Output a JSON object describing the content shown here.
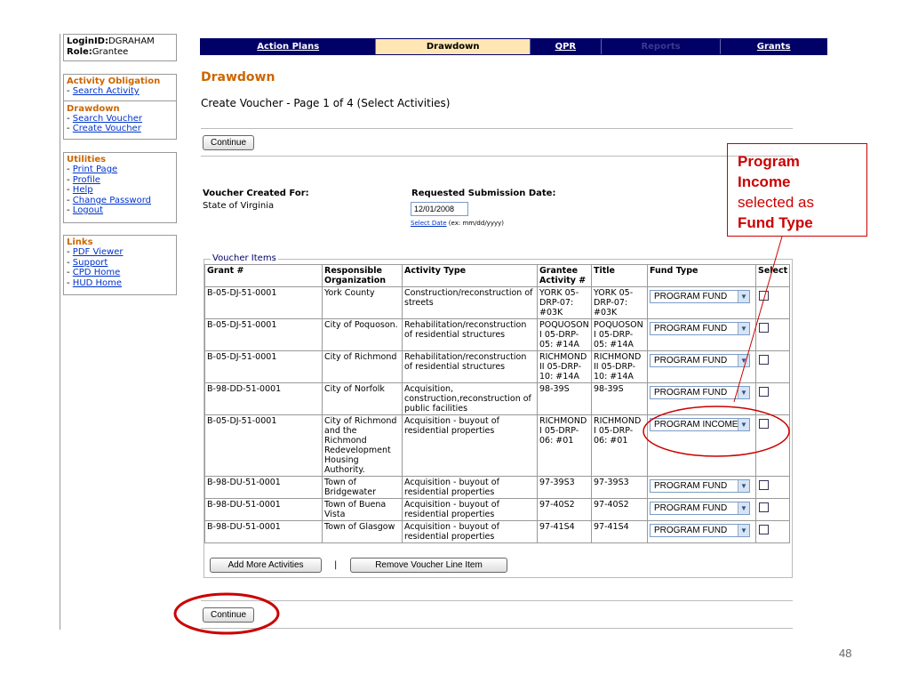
{
  "login": {
    "id_label": "LoginID:",
    "id_value": "DGRAHAM",
    "role_label": "Role:",
    "role_value": "Grantee"
  },
  "sidebar": {
    "activity_title": "Activity Obligation",
    "activity_items": [
      "Search Activity"
    ],
    "drawdown_title": "Drawdown",
    "drawdown_items": [
      "Search Voucher",
      "Create Voucher"
    ],
    "utilities_title": "Utilities",
    "utilities_items": [
      "Print Page",
      "Profile",
      "Help",
      "Change Password",
      "Logout"
    ],
    "links_title": "Links",
    "links_items": [
      "PDF Viewer",
      "Support",
      "CPD Home",
      "HUD Home"
    ]
  },
  "nav": {
    "tabs": [
      "Action Plans",
      "Drawdown",
      "QPR",
      "Reports",
      "Grants"
    ]
  },
  "page": {
    "title": "Drawdown",
    "subtitle": "Create Voucher - Page 1 of 4 (Select Activities)",
    "continue_label": "Continue",
    "voucher_for_label": "Voucher Created For:",
    "voucher_for_value": "State of Virginia",
    "submission_label": "Requested Submission Date:",
    "submission_value": "12/01/2008",
    "select_date": "Select Date",
    "date_hint": "(ex: mm/dd/yyyy)",
    "legend": "Voucher Items",
    "add_more": "Add More Activities",
    "pipe": "|",
    "remove": "Remove Voucher Line Item"
  },
  "table": {
    "headers": [
      "Grant #",
      "Responsible Organization",
      "Activity Type",
      "Grantee Activity #",
      "Title",
      "Fund Type",
      "Select"
    ],
    "rows": [
      {
        "grant": "B-05-DJ-51-0001",
        "org": "York County",
        "activity": "Construction/reconstruction of streets",
        "gid": "YORK 05-DRP-07: #03K",
        "title": "YORK 05-DRP-07: #03K",
        "fund": "PROGRAM FUND"
      },
      {
        "grant": "B-05-DJ-51-0001",
        "org": "City of Poquoson.",
        "activity": "Rehabilitation/reconstruction of residential structures",
        "gid": "POQUOSON I 05-DRP-05: #14A",
        "title": "POQUOSON I 05-DRP-05: #14A",
        "fund": "PROGRAM FUND"
      },
      {
        "grant": "B-05-DJ-51-0001",
        "org": "City of Richmond",
        "activity": "Rehabilitation/reconstruction of residential structures",
        "gid": "RICHMOND II 05-DRP-10: #14A",
        "title": "RICHMOND II 05-DRP-10: #14A",
        "fund": "PROGRAM FUND"
      },
      {
        "grant": "B-98-DD-51-0001",
        "org": "City of Norfolk",
        "activity": "Acquisition, construction,reconstruction of public facilities",
        "gid": "98-39S",
        "title": "98-39S",
        "fund": "PROGRAM FUND"
      },
      {
        "grant": "B-05-DJ-51-0001",
        "org": "City of Richmond and the Richmond Redevelopment Housing Authority.",
        "activity": "Acquisition - buyout of residential properties",
        "gid": "RICHMOND I 05-DRP-06: #01",
        "title": "RICHMOND I 05-DRP-06: #01",
        "fund": "PROGRAM INCOME"
      },
      {
        "grant": "B-98-DU-51-0001",
        "org": "Town of Bridgewater",
        "activity": "Acquisition - buyout of residential properties",
        "gid": "97-39S3",
        "title": "97-39S3",
        "fund": "PROGRAM FUND"
      },
      {
        "grant": "B-98-DU-51-0001",
        "org": "Town of Buena Vista",
        "activity": "Acquisition - buyout of residential properties",
        "gid": "97-40S2",
        "title": "97-40S2",
        "fund": "PROGRAM FUND"
      },
      {
        "grant": "B-98-DU-51-0001",
        "org": "Town of Glasgow",
        "activity": "Acquisition - buyout of residential properties",
        "gid": "97-41S4",
        "title": "97-41S4",
        "fund": "PROGRAM FUND"
      }
    ]
  },
  "annotation": {
    "line1": "Program",
    "line2": "Income",
    "line3": "selected as",
    "line4": "Fund Type"
  },
  "slide_number": "48",
  "colors": {
    "nav_bg": "#000066",
    "nav_active": "#ffe6b3",
    "section_title": "#cc6600",
    "annotation": "#cc0000",
    "link": "#0033cc"
  }
}
